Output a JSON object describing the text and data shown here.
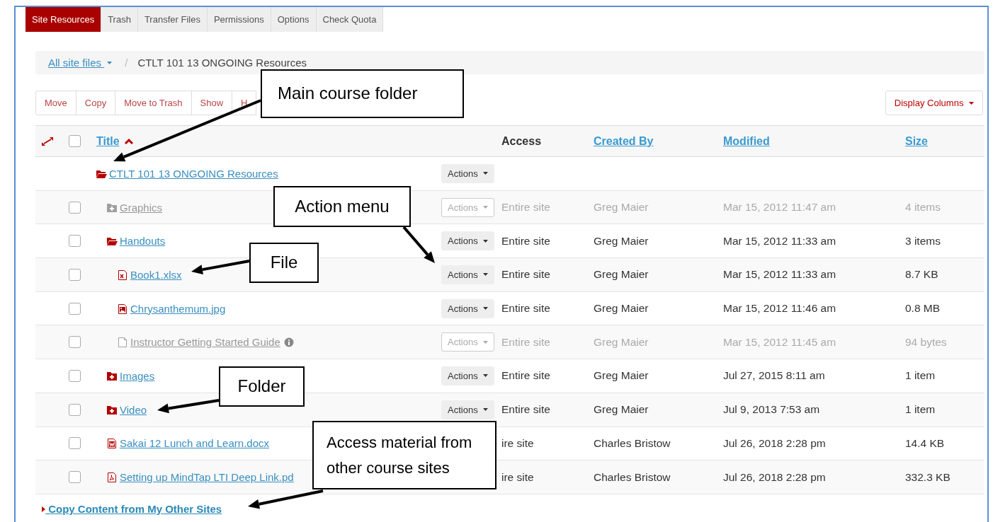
{
  "tabs": [
    {
      "label": "Site Resources",
      "selected": true
    },
    {
      "label": "Trash",
      "selected": false
    },
    {
      "label": "Transfer Files",
      "selected": false
    },
    {
      "label": "Permissions",
      "selected": false
    },
    {
      "label": "Options",
      "selected": false
    },
    {
      "label": "Check Quota",
      "selected": false
    }
  ],
  "breadcrumb": {
    "root": "All site files",
    "separator": "/",
    "current": "CTLT 101 13 ONGOING Resources"
  },
  "toolbar": {
    "buttons": [
      "Move",
      "Copy",
      "Move to Trash",
      "Show",
      "H"
    ],
    "display_columns": "Display Columns"
  },
  "table": {
    "select_all": {
      "checked": false
    },
    "columns": [
      {
        "label": "Title",
        "link": true,
        "sorted": true
      },
      {
        "label": "Access",
        "link": false,
        "sorted": false
      },
      {
        "label": "Created By",
        "link": true,
        "sorted": false
      },
      {
        "label": "Modified",
        "link": true,
        "sorted": false
      },
      {
        "label": "Size",
        "link": true,
        "sorted": false
      }
    ],
    "rows": [
      {
        "kind": "folder-open",
        "title": "CTLT 101 13 ONGOING Resources",
        "actions": "Actions",
        "hidden": false,
        "children": [
          {
            "kind": "folder",
            "title": "Graphics",
            "checked": false,
            "actions": "Actions",
            "hidden": true,
            "access": "Entire site",
            "created_by": "Greg Maier",
            "modified": "Mar 15, 2012 11:47 am",
            "size": "4 items"
          },
          {
            "kind": "folder-open",
            "title": "Handouts",
            "checked": false,
            "actions": "Actions",
            "hidden": false,
            "access": "Entire site",
            "created_by": "Greg Maier",
            "modified": "Mar 15, 2012 11:33 am",
            "size": "3 items",
            "children": [
              {
                "kind": "spreadsheet",
                "title": "Book1.xlsx",
                "checked": false,
                "actions": "Actions",
                "hidden": false,
                "access": "Entire site",
                "created_by": "Greg Maier",
                "modified": "Mar 15, 2012 11:33 am",
                "size": "8.7 KB"
              },
              {
                "kind": "image",
                "title": "Chrysanthemum.jpg",
                "checked": false,
                "actions": "Actions",
                "hidden": false,
                "access": "Entire site",
                "created_by": "Greg Maier",
                "modified": "Mar 15, 2012 11:46 am",
                "size": "0.8 MB"
              },
              {
                "kind": "file",
                "title": "Instructor Getting Started Guide",
                "info": true,
                "checked": false,
                "actions": "Actions",
                "hidden": true,
                "access": "Entire site",
                "created_by": "Greg Maier",
                "modified": "Mar 15, 2012 11:45 am",
                "size": "94 bytes"
              }
            ]
          },
          {
            "kind": "folder",
            "title": "Images",
            "checked": false,
            "actions": "Actions",
            "hidden": false,
            "access": "Entire site",
            "created_by": "Greg Maier",
            "modified": "Jul 27, 2015 8:11 am",
            "size": "1 item"
          },
          {
            "kind": "folder",
            "title": "Video",
            "checked": false,
            "actions": "Actions",
            "hidden": false,
            "access": "Entire site",
            "created_by": "Greg Maier",
            "modified": "Jul 9, 2013 7:53 am",
            "size": "1 item"
          },
          {
            "kind": "word",
            "title": "Sakai 12 Lunch and Learn.docx",
            "checked": false,
            "hidden": false,
            "access": "ire site",
            "created_by": "Charles Bristow",
            "modified": "Jul 26, 2018 2:28 pm",
            "size": "14.4 KB"
          },
          {
            "kind": "pdf",
            "title": "Setting up MindTap LTI Deep Link.pd",
            "checked": false,
            "hidden": false,
            "access": "ire site",
            "created_by": "Charles Bristow",
            "modified": "Jul 26, 2018 2:28 pm",
            "size": "332.3 KB"
          }
        ]
      }
    ]
  },
  "footer_link": "Copy Content from My Other Sites",
  "callouts": [
    {
      "text": "Main course folder"
    },
    {
      "text": "Action menu"
    },
    {
      "text": "File"
    },
    {
      "text": "Folder"
    },
    {
      "text": "Access material from other course sites"
    }
  ]
}
